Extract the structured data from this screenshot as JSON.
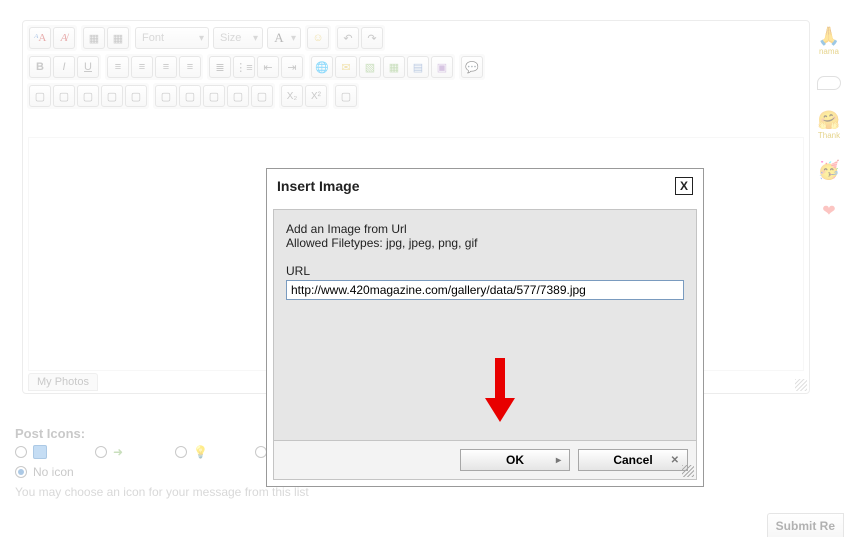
{
  "editor": {
    "font_select": "Font",
    "size_select": "Size",
    "a_button": "A",
    "my_photos_tab": "My Photos",
    "row3": {
      "x2_sub": "X₂",
      "x2_sup": "X²"
    }
  },
  "post_icons": {
    "heading": "Post Icons:",
    "no_icon_label": "No icon",
    "hint": "You may choose an icon for your message from this list"
  },
  "dialog": {
    "title": "Insert Image",
    "line1": "Add an Image from Url",
    "line2": "Allowed Filetypes: jpg, jpeg, png, gif",
    "url_label": "URL",
    "url_value": "http://www.420magazine.com/gallery/data/577/7389.jpg",
    "ok": "OK",
    "cancel": "Cancel"
  },
  "sidebar": {
    "label1": "nama",
    "label2": "Thank"
  },
  "submit_label": "Submit Re"
}
